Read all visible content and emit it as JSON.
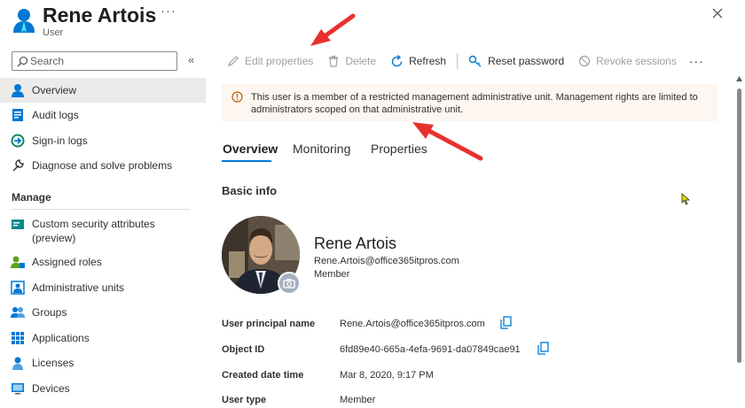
{
  "header": {
    "title": "Rene Artois",
    "subtitle": "User",
    "more_label": "···",
    "icon": "user-icon"
  },
  "search": {
    "placeholder": "Search"
  },
  "sidebar": {
    "collapse_label": "«",
    "items": [
      {
        "label": "Overview",
        "icon": "user-icon",
        "active": true
      },
      {
        "label": "Audit logs",
        "icon": "audit-log-icon"
      },
      {
        "label": "Sign-in logs",
        "icon": "sign-in-icon"
      },
      {
        "label": "Diagnose and solve problems",
        "icon": "wrench-icon"
      }
    ],
    "section": "Manage",
    "manage_items": [
      {
        "label": "Custom security attributes",
        "label2": "(preview)",
        "icon": "security-attributes-icon"
      },
      {
        "label": "Assigned roles",
        "icon": "assigned-roles-icon"
      },
      {
        "label": "Administrative units",
        "icon": "admin-units-icon"
      },
      {
        "label": "Groups",
        "icon": "groups-icon"
      },
      {
        "label": "Applications",
        "icon": "applications-icon"
      },
      {
        "label": "Licenses",
        "icon": "licenses-icon"
      },
      {
        "label": "Devices",
        "icon": "devices-icon"
      }
    ]
  },
  "toolbar": {
    "edit_properties": "Edit properties",
    "delete": "Delete",
    "refresh": "Refresh",
    "reset_password": "Reset password",
    "revoke_sessions": "Revoke sessions",
    "more": "···"
  },
  "banner": {
    "text": "This user is a member of a restricted management administrative unit. Management rights are limited to administrators scoped on that administrative unit.",
    "icon": "info-icon",
    "color": "#fdf6f1"
  },
  "tabs": [
    "Overview",
    "Monitoring",
    "Properties"
  ],
  "basic_info": {
    "heading": "Basic info",
    "name": "Rene Artois",
    "email": "Rene.Artois@office365itpros.com",
    "user_type": "Member"
  },
  "properties": [
    {
      "label": "User principal name",
      "value": "Rene.Artois@office365itpros.com",
      "copy": true
    },
    {
      "label": "Object ID",
      "value": "6fd89e40-665a-4efa-9691-da07849cae91",
      "copy": true
    },
    {
      "label": "Created date time",
      "value": "Mar 8, 2020, 9:17 PM",
      "copy": false
    },
    {
      "label": "User type",
      "value": "Member",
      "copy": false
    }
  ],
  "colors": {
    "accent": "#0078d4",
    "annotation_arrow": "#e8312f"
  }
}
